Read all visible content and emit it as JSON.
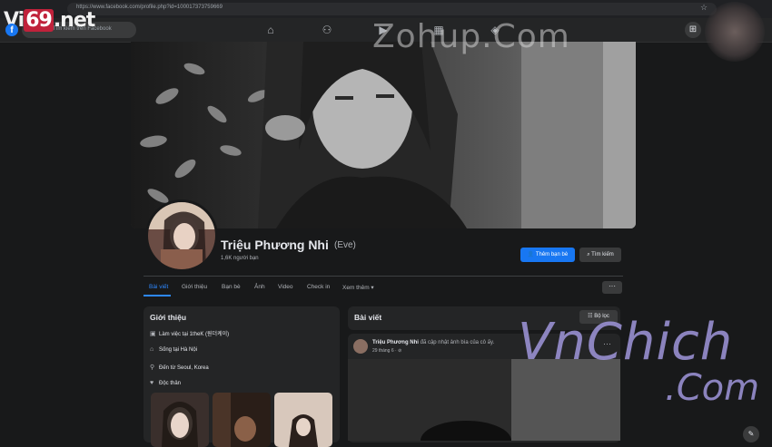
{
  "browser": {
    "url": "https://www.facebook.com/profile.php?id=100017373759669",
    "star_icon": "star-icon"
  },
  "watermarks": {
    "logo_prefix": "Vi",
    "logo_number": "69",
    "logo_suffix": ".net",
    "center": "Zohup.Com",
    "bottom_line1": "VnChich",
    "bottom_line2": ".Com"
  },
  "fb": {
    "search_placeholder": "Tìm kiếm trên Facebook",
    "nav_icons": [
      "home-icon",
      "friends-icon",
      "video-icon",
      "marketplace-icon",
      "gaming-icon"
    ]
  },
  "profile": {
    "name": "Triệu Phương Nhi",
    "alt_name": "(Eve)",
    "friends_count": "1,6K người bạn",
    "add_friend_label": "Thêm bạn bè",
    "search_label": "Tìm kiếm"
  },
  "tabs": [
    {
      "label": "Bài viết",
      "active": true
    },
    {
      "label": "Giới thiệu",
      "active": false
    },
    {
      "label": "Bạn bè",
      "active": false
    },
    {
      "label": "Ảnh",
      "active": false
    },
    {
      "label": "Video",
      "active": false
    },
    {
      "label": "Check in",
      "active": false
    },
    {
      "label": "Xem thêm ▾",
      "active": false
    }
  ],
  "intro": {
    "title": "Giới thiệu",
    "items": [
      {
        "icon": "work-icon",
        "text": "Làm việc tại 1theK (원더케이)"
      },
      {
        "icon": "home-icon",
        "text": "Sống tại Hà Nội"
      },
      {
        "icon": "location-icon",
        "text": "Đến từ Seoul, Korea"
      },
      {
        "icon": "heart-icon",
        "text": "Độc thân"
      }
    ]
  },
  "posts": {
    "title": "Bài viết",
    "filter_label": "Bộ lọc",
    "first_post": {
      "author": "Triệu Phương Nhi",
      "action": "đã cập nhật ảnh bìa của cô ấy.",
      "time": "29 tháng 6 · ⊘"
    }
  }
}
